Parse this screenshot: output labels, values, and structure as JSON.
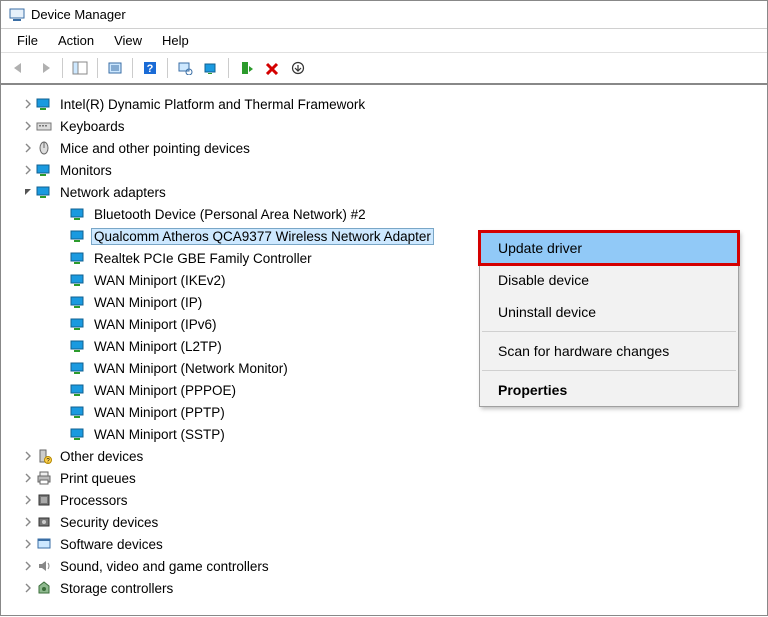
{
  "title": "Device Manager",
  "menu": {
    "file": "File",
    "action": "Action",
    "view": "View",
    "help": "Help"
  },
  "top_nodes": [
    {
      "label": "Intel(R) Dynamic Platform and Thermal Framework",
      "icon": "monitor"
    },
    {
      "label": "Keyboards",
      "icon": "keyboard"
    },
    {
      "label": "Mice and other pointing devices",
      "icon": "mouse"
    },
    {
      "label": "Monitors",
      "icon": "monitor"
    }
  ],
  "network_group_label": "Network adapters",
  "network_children": [
    {
      "label": "Bluetooth Device (Personal Area Network) #2"
    },
    {
      "label": "Qualcomm Atheros QCA9377 Wireless Network Adapter",
      "selected": true
    },
    {
      "label": "Realtek PCIe GBE Family Controller"
    },
    {
      "label": "WAN Miniport (IKEv2)"
    },
    {
      "label": "WAN Miniport (IP)"
    },
    {
      "label": "WAN Miniport (IPv6)"
    },
    {
      "label": "WAN Miniport (L2TP)"
    },
    {
      "label": "WAN Miniport (Network Monitor)"
    },
    {
      "label": "WAN Miniport (PPPOE)"
    },
    {
      "label": "WAN Miniport (PPTP)"
    },
    {
      "label": "WAN Miniport (SSTP)"
    }
  ],
  "bottom_nodes": [
    {
      "label": "Other devices",
      "icon": "other"
    },
    {
      "label": "Print queues",
      "icon": "printer"
    },
    {
      "label": "Processors",
      "icon": "chip"
    },
    {
      "label": "Security devices",
      "icon": "security"
    },
    {
      "label": "Software devices",
      "icon": "software"
    },
    {
      "label": "Sound, video and game controllers",
      "icon": "sound"
    },
    {
      "label": "Storage controllers",
      "icon": "storage"
    }
  ],
  "context_menu": {
    "update": "Update driver",
    "disable": "Disable device",
    "uninstall": "Uninstall device",
    "scan": "Scan for hardware changes",
    "props": "Properties"
  }
}
